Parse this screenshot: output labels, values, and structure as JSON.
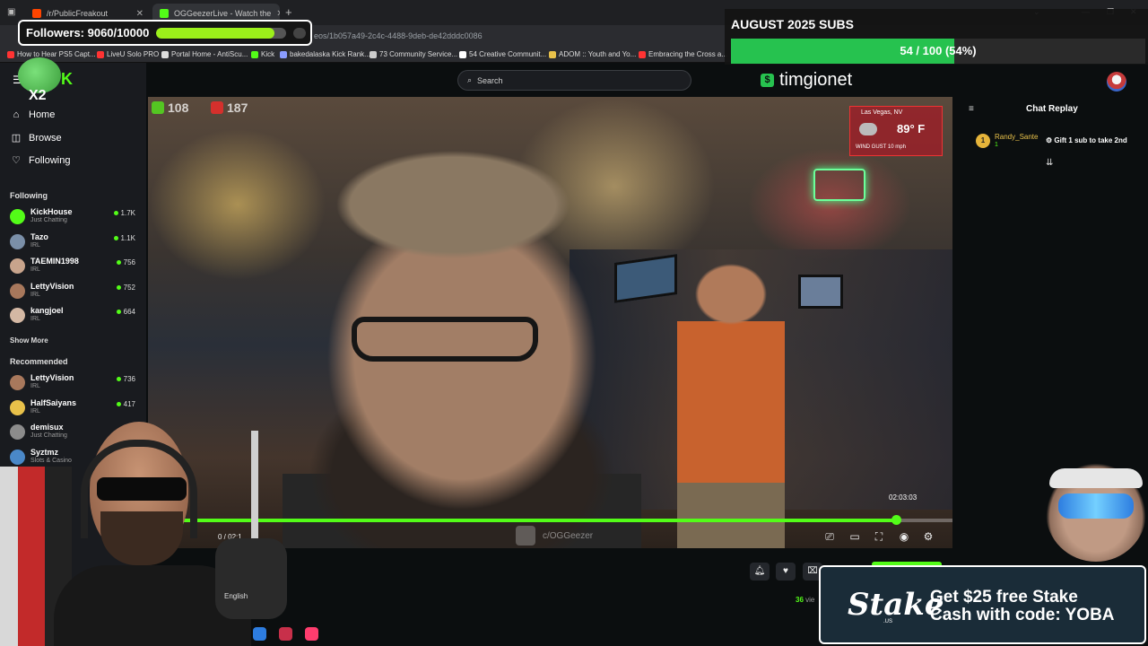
{
  "browser": {
    "tabs": [
      {
        "title": "/r/PublicFreakout",
        "favicon_color": "#ff4500"
      },
      {
        "title": "OGGeezerLive - Watch the",
        "favicon_color": "#53fc18"
      }
    ],
    "url": "eos/1b057a49-2c4c-4488-9deb-de42dddc0086",
    "bookmarks": [
      {
        "label": "How to Hear PS5 Capt...",
        "color": "#ff3333"
      },
      {
        "label": "LiveU Solo PRO",
        "color": "#ff3333"
      },
      {
        "label": "Portal Home - AntiScu...",
        "color": "#dddddd"
      },
      {
        "label": "Kick",
        "color": "#53fc18"
      },
      {
        "label": "bakedalaska Kick Rank...",
        "color": "#8a9cff"
      },
      {
        "label": "73 Community Service...",
        "color": "#cccccc"
      },
      {
        "label": "54 Creative Communit...",
        "color": "#ffffff"
      },
      {
        "label": "ADOM :: Youth and Yo...",
        "color": "#e8c14a"
      },
      {
        "label": "Embracing the Cross a...",
        "color": "#ff3333"
      }
    ]
  },
  "sidebar": {
    "nav": [
      {
        "label": "Home",
        "icon": "home-icon"
      },
      {
        "label": "Browse",
        "icon": "browse-icon"
      },
      {
        "label": "Following",
        "icon": "heart-icon"
      }
    ],
    "following_title": "Following",
    "following": [
      {
        "name": "KickHouse",
        "category": "Just Chatting",
        "viewers": "1.7K",
        "avatar_color": "#53fc18"
      },
      {
        "name": "Tazo",
        "category": "IRL",
        "viewers": "1.1K",
        "avatar_color": "#7a8fa8"
      },
      {
        "name": "TAEMIN1998",
        "category": "IRL",
        "viewers": "756",
        "avatar_color": "#c8a48c"
      },
      {
        "name": "LettyVision",
        "category": "IRL",
        "viewers": "752",
        "avatar_color": "#a8785c"
      },
      {
        "name": "kangjoel",
        "category": "IRL",
        "viewers": "664",
        "avatar_color": "#d4b8a4"
      }
    ],
    "show_more": "Show More",
    "recommended_title": "Recommended",
    "recommended": [
      {
        "name": "LettyVision",
        "category": "IRL",
        "viewers": "736",
        "avatar_color": "#a8785c"
      },
      {
        "name": "HalfSaiyans",
        "category": "IRL",
        "viewers": "417",
        "avatar_color": "#e8c14a"
      },
      {
        "name": "demisux",
        "category": "Just Chatting",
        "viewers": "",
        "avatar_color": "#8c8c8c"
      },
      {
        "name": "Syztmz",
        "category": "Slots & Casino",
        "viewers": "",
        "avatar_color": "#4a88c8"
      }
    ]
  },
  "search": {
    "placeholder": "Search"
  },
  "video": {
    "viewer_count_left": "108",
    "viewer_count_right": "187",
    "weather": {
      "city": "Las Vegas, NV",
      "temp": "89° F",
      "wind": "WIND GUST 10 mph"
    },
    "hover_time": "02:03:03",
    "time_display": "0 / 02:1",
    "progress": 0.93,
    "watermark": "c/OGGeezer"
  },
  "chat": {
    "title": "Chat Replay",
    "messages": [
      {
        "badge": "1",
        "user": "Randy_Sante",
        "sub_count": "1",
        "text": "Gift 1 sub to take 2nd"
      }
    ]
  },
  "below_video": {
    "viewers_count": "36",
    "viewers_label": " vie",
    "language": "English"
  },
  "overlays": {
    "followers_label": "Followers: 9060/10000",
    "followers_progress": 0.906,
    "subs_title": "AUGUST 2025 SUBS",
    "subs_label": "54 / 100 (54%)",
    "subs_progress": 0.54,
    "channel_name": "timgionet",
    "logo_text": "X2",
    "stake_logo": "Stake",
    "stake_sub": ".US",
    "stake_line1": "Get $25 free Stake",
    "stake_line2": "Cash with code: YOBA"
  },
  "colors": {
    "kick_green": "#53fc18",
    "subs_green": "#26c24f",
    "follow_green": "#9cf01a"
  }
}
